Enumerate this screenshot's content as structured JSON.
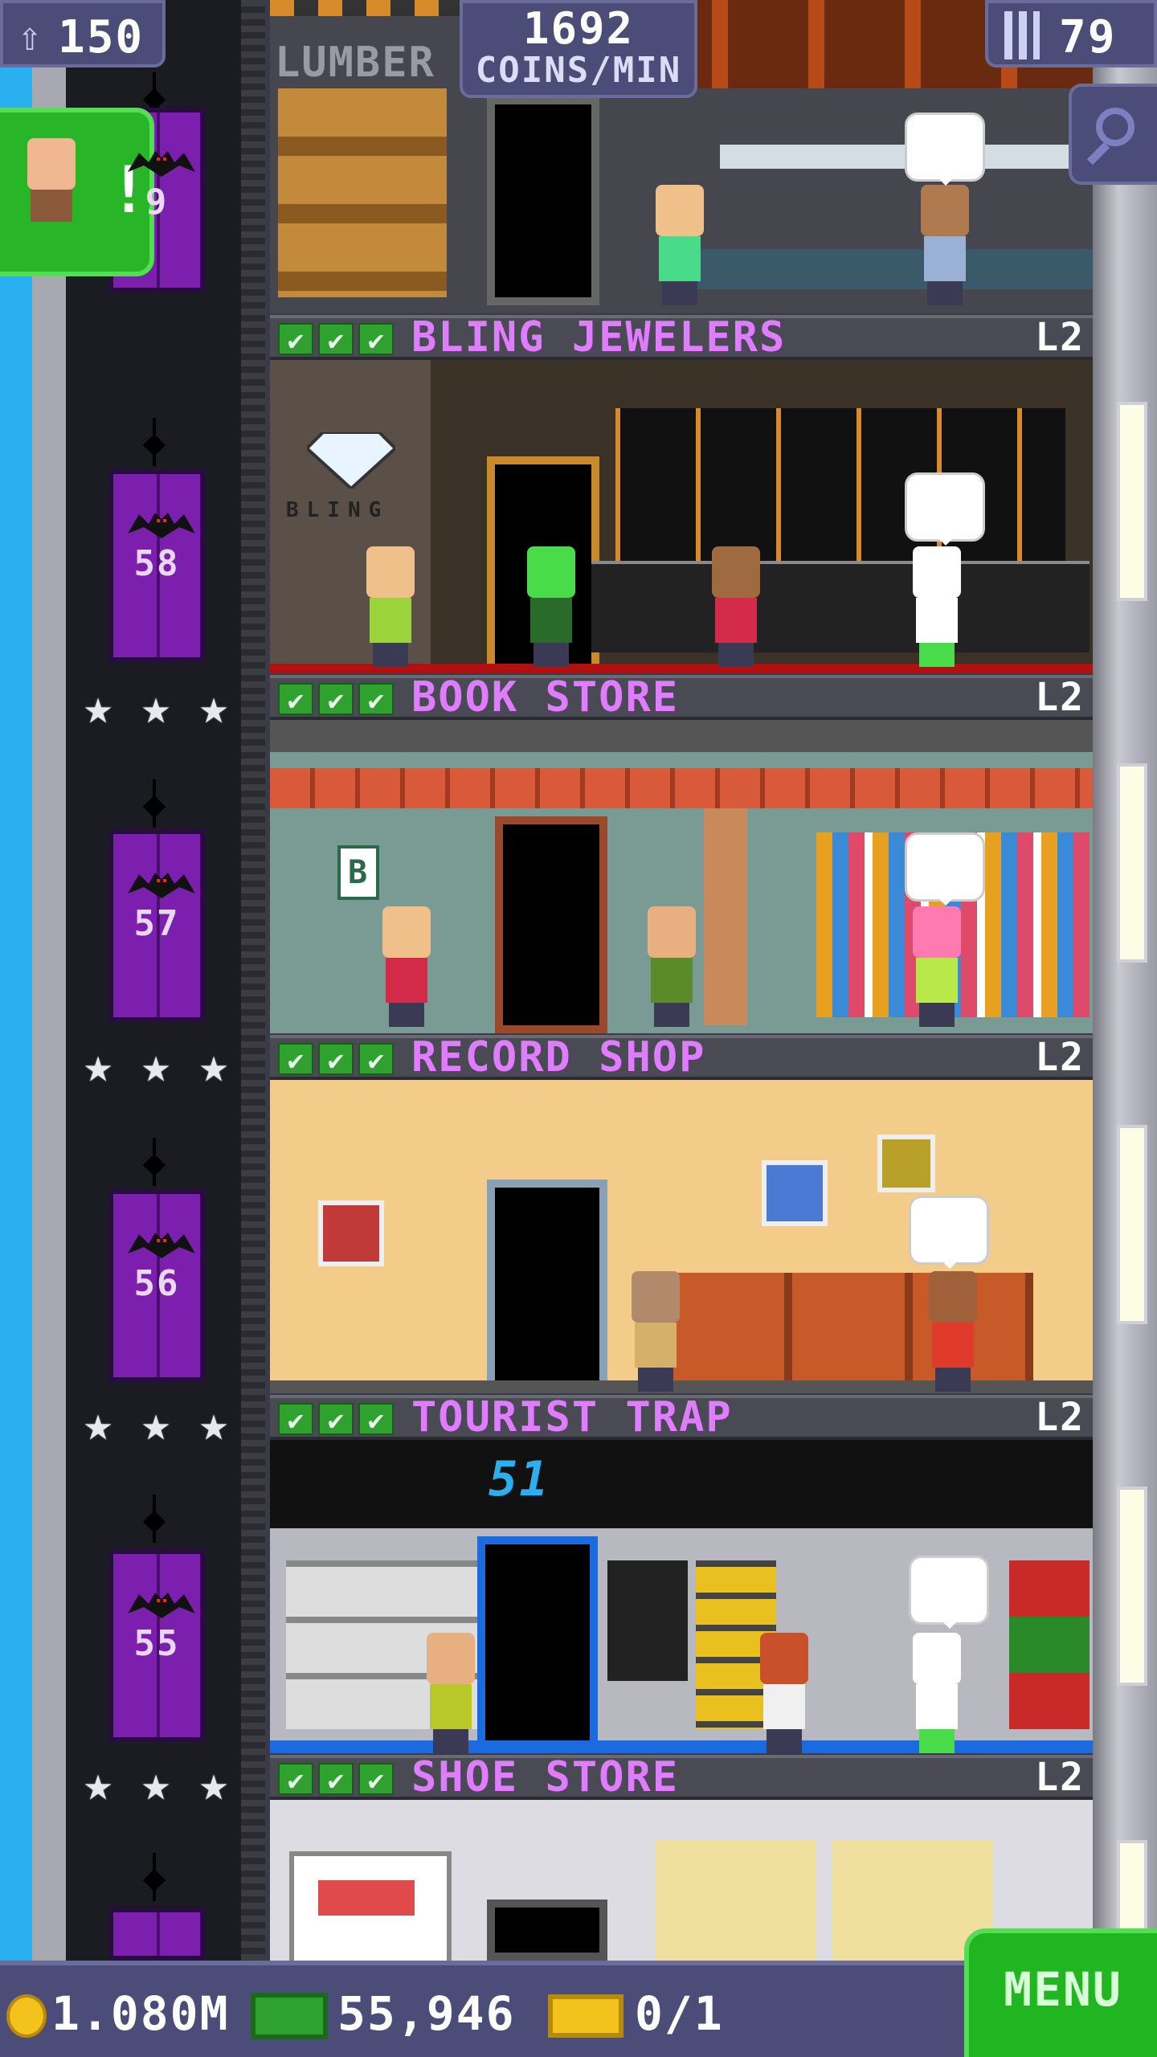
{
  "hud": {
    "population": "150",
    "coins_per_min_value": "1692",
    "coins_per_min_label": "COINS/MIN",
    "floor_count": "79"
  },
  "top_floor": {
    "sign": "LUMBER"
  },
  "elevator": {
    "floors": [
      "9",
      "58",
      "57",
      "56",
      "55"
    ]
  },
  "floors": [
    {
      "name": "BLING JEWELERS",
      "level": "L2",
      "sign": "BLING"
    },
    {
      "name": "BOOK STORE",
      "level": "L2",
      "sign": "B"
    },
    {
      "name": "RECORD SHOP",
      "level": "L2"
    },
    {
      "name": "TOURIST TRAP",
      "level": "L2",
      "sign": "51"
    },
    {
      "name": "SHOE STORE",
      "level": "L2"
    }
  ],
  "star": "★",
  "check": "✔",
  "bottom_bar": {
    "coins": "1.080M",
    "bux": "55,946",
    "tickets": "0/1",
    "menu_label": "MENU"
  },
  "icons": [
    "population-icon",
    "floors-icon",
    "search-icon",
    "coin-icon",
    "bux-icon",
    "ticket-icon",
    "bat-icon",
    "star-icon",
    "check-icon"
  ],
  "colors": {
    "hud_bg": "#4b4d78",
    "floor_name": "#e07cff",
    "elevator": "#7d1fae",
    "menu": "#22b522"
  }
}
